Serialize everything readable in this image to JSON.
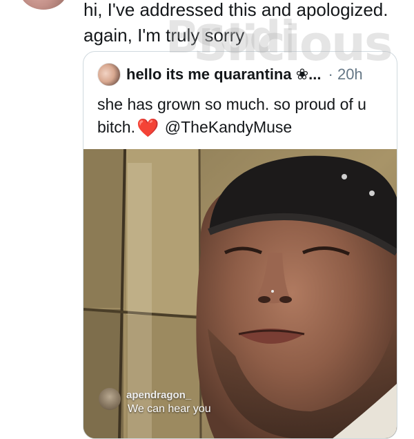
{
  "tweet": {
    "text": "hi, I've addressed this and apologized.\nagain, I'm truly sorry"
  },
  "watermark": {
    "text_left": "Brodi",
    "text_right": "Slicious"
  },
  "quote": {
    "author_name": "hello its me quarantina ❀...",
    "separator": "·",
    "time": "20h",
    "text_part1": "she has grown so much. so proud of u bitch.",
    "heart": "❤️",
    "mention": "@TheKandyMuse"
  },
  "media": {
    "overlay_username": "apendragon_",
    "overlay_comment": "We can hear you"
  }
}
